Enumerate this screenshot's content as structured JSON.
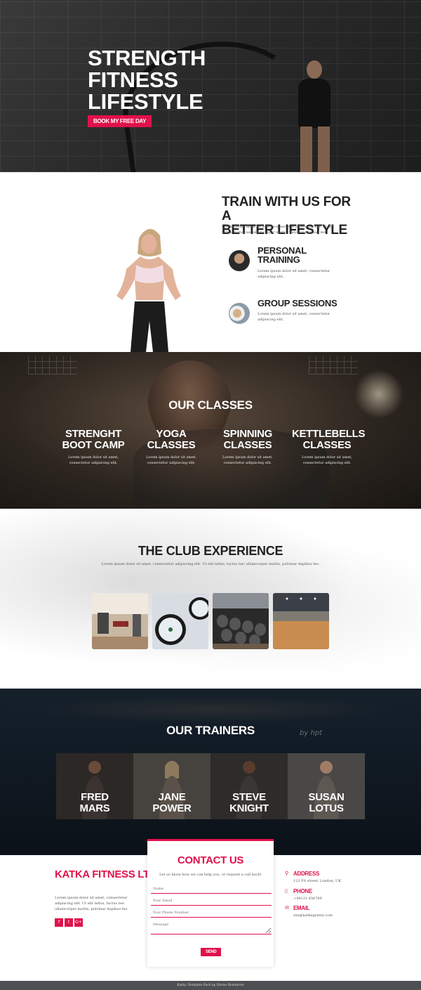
{
  "hero": {
    "title_line1": "STRENGTH",
    "title_line2": "FITNESS",
    "title_line3": "LIFESTYLE",
    "cta_label": "BOOK MY FREE DAY"
  },
  "train": {
    "title_line1": "TRAIN WITH US FOR A",
    "title_line2": "BETTER LIFESTYLE",
    "intro": "Lorem ipsum dolor sit amet, consectetur adipiscing elit. Ut elit tellus, luctus nec ullamcorper mattis, pulvinar dapibus leo.",
    "features": [
      {
        "title_line1": "PERSONAL",
        "title_line2": "TRAINING",
        "text": "Lorem ipsum dolor sit amet, consectetur adipiscing elit."
      },
      {
        "title_line1": "GROUP SESSIONS",
        "title_line2": "",
        "text": "Lorem ipsum dolor sit amet, consectetur adipiscing elit."
      }
    ]
  },
  "classes": {
    "title": "OUR CLASSES",
    "items": [
      {
        "line1": "STRENGHT",
        "line2": "BOOT CAMP",
        "text": "Lorem ipsum dolor sit amet, consectetur adipiscing elit."
      },
      {
        "line1": "YOGA",
        "line2": "CLASSES",
        "text": "Lorem ipsum dolor sit amet, consectetur adipiscing elit."
      },
      {
        "line1": "SPINNING",
        "line2": "CLASSES",
        "text": "Lorem ipsum dolor sit amet, consectetur adipiscing elit."
      },
      {
        "line1": "KETTLEBELLS",
        "line2": "CLASSES",
        "text": "Lorem ipsum dolor sit amet, consectetur adipiscing elit."
      }
    ]
  },
  "club": {
    "title": "THE CLUB EXPERIENCE",
    "intro": "Lorem ipsum dolor sit amet, consectetur adipiscing elit. Ut elit tellus, luctus nec ullamcorper mattis, pulvinar dapibus leo."
  },
  "trainers": {
    "title": "OUR TRAINERS",
    "logo": "by hpt",
    "people": [
      {
        "first": "FRED",
        "last": "MARS"
      },
      {
        "first": "JANE",
        "last": "POWER"
      },
      {
        "first": "STEVE",
        "last": "KNIGHT"
      },
      {
        "first": "SUSAN",
        "last": "LOTUS"
      }
    ]
  },
  "contact": {
    "company": "KATKA FITNESS LTD.",
    "about": "Lorem ipsum dolor sit amet, consectetur adipiscing elit. Ut elit tellus, luctus nec ullamcorper mattis, pulvinar dapibus leo.",
    "social": [
      "f",
      "t",
      "G+"
    ],
    "card_title": "CONTACT US",
    "card_sub": "Let us know how we can help you, or request a call back!",
    "fields": {
      "name": "Name",
      "email": "Your Email",
      "phone": "Your Phone Number",
      "message": "Message"
    },
    "send_label": "SEND",
    "address_label": "ADDRESS",
    "address_value": "123 Fit street, London, UK",
    "phone_label": "PHONE",
    "phone_value": "+44123 456789",
    "email_label": "EMAIL",
    "email_value": "xxx@katkagymxx.com"
  },
  "footer": {
    "text": "Katka Template Pack by Divine Bomberos"
  },
  "colors": {
    "accent": "#e0114b",
    "dark": "#222222",
    "footer_bg": "#4d4f52"
  }
}
